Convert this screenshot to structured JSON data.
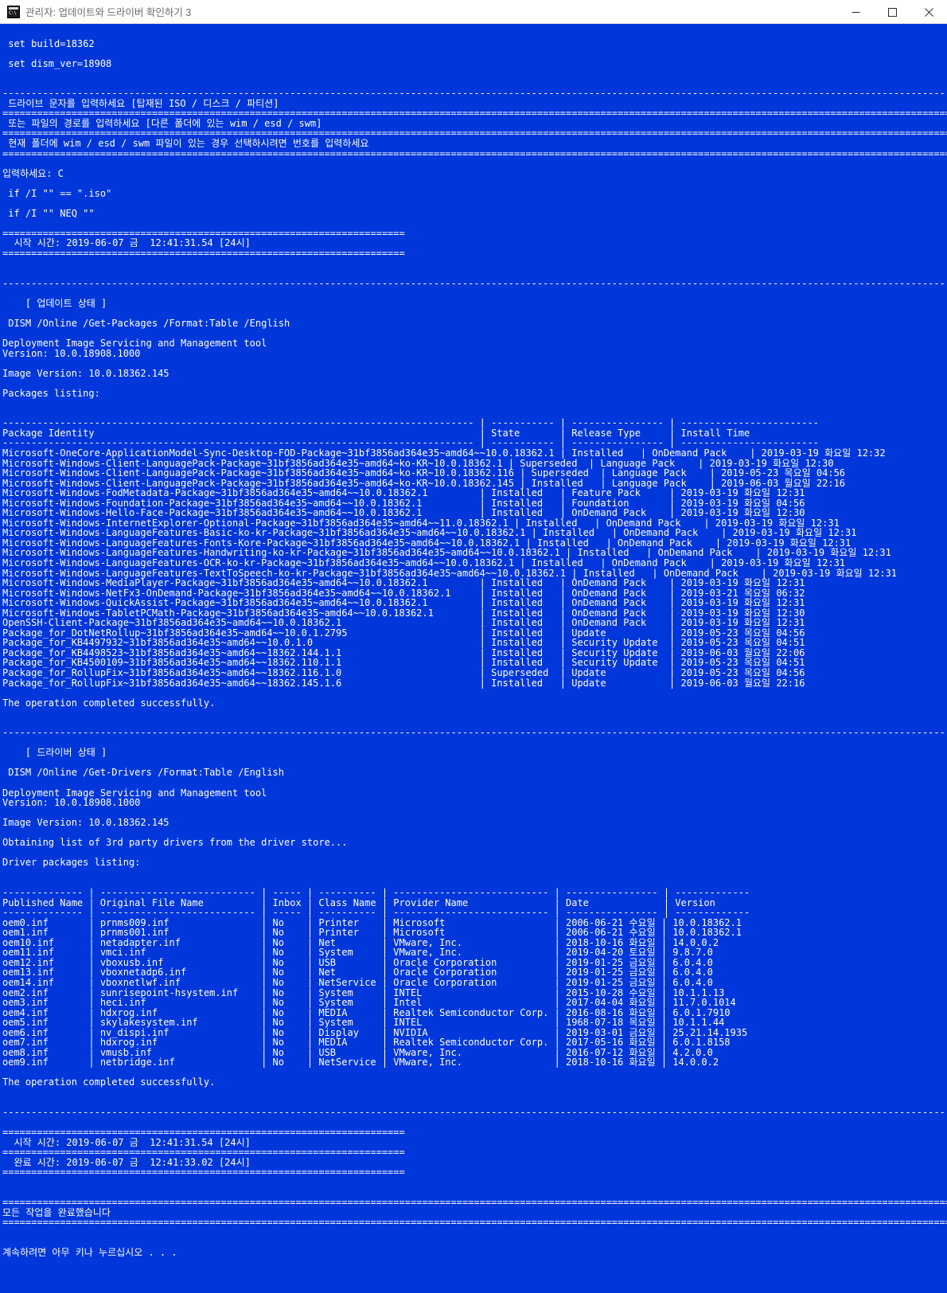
{
  "window": {
    "title": "관리자: 업데이트와 드라이버 확인하기 3",
    "icon": "console-icon",
    "minimize_label": "—",
    "maximize_label": "□",
    "close_label": "✕"
  },
  "colors": {
    "console_background": "#0037da",
    "console_text": "#ffffff",
    "titlebar_background": "#ffffff",
    "titlebar_text": "#6b6b6b"
  },
  "console": {
    "set_build": "set build=18362",
    "set_dism_ver": "set dism_ver=18908",
    "prompt_drive": "드라이브 문자를 입력하세요 [탑재된 ISO / 디스크 / 파티션]",
    "prompt_path": "또는 파일의 경로를 입력하세요 [다른 폴더에 있는 wim / esd / swm]",
    "prompt_number": "현재 폴더에 wim / esd / swm 파일이 있는 경우 선택하시려면 번호를 입력하세요",
    "input_line": "입력하세요: C",
    "if_iso": " if /I \"\" == \".iso\"",
    "if_neq": " if /I \"\" NEQ \"\"",
    "start_time_top": "  시작 시간: 2019-06-07 금  12:41:31.54 [24시]",
    "update_status_header": "    [ 업데이트 상태 ]",
    "dism_packages_cmd": " DISM /Online /Get-Packages /Format:Table /English",
    "dism_tool_line1": "Deployment Image Servicing and Management tool",
    "dism_tool_version": "Version: 10.0.18908.1000",
    "image_version": "Image Version: 10.0.18362.145",
    "packages_listing": "Packages listing:",
    "operation_completed": "The operation completed successfully.",
    "driver_status_header": "    [ 드라이버 상태 ]",
    "dism_drivers_cmd": " DISM /Online /Get-Drivers /Format:Table /English",
    "obtaining_drivers": "Obtaining list of 3rd party drivers from the driver store...",
    "driver_packages_listing": "Driver packages listing:",
    "start_time_bottom": "  시작 시간: 2019-06-07 금  12:41:31.54 [24시]",
    "end_time_bottom": "  완료 시간: 2019-06-07 금  12:41:33.02 [24시]",
    "all_done": "모든 작업을 완료했습니다",
    "press_any_key": "계속하려면 아무 키나 누르십시오 . . ."
  },
  "packages_table": {
    "headers": [
      "Package Identity",
      "State",
      "Release Type",
      "Install Time"
    ],
    "rows": [
      [
        "Microsoft-OneCore-ApplicationModel-Sync-Desktop-FOD-Package~31bf3856ad364e35~amd64~~10.0.18362.1",
        "Installed",
        "OnDemand Pack",
        "2019-03-19 화요일 12:32"
      ],
      [
        "Microsoft-Windows-Client-LanguagePack-Package~31bf3856ad364e35~amd64~ko-KR~10.0.18362.1",
        "Superseded",
        "Language Pack",
        "2019-03-19 화요일 12:30"
      ],
      [
        "Microsoft-Windows-Client-LanguagePack-Package~31bf3856ad364e35~amd64~ko-KR~10.0.18362.116",
        "Superseded",
        "Language Pack",
        "2019-05-23 목요일 04:56"
      ],
      [
        "Microsoft-Windows-Client-LanguagePack-Package~31bf3856ad364e35~amd64~ko-KR~10.0.18362.145",
        "Installed",
        "Language Pack",
        "2019-06-03 월요일 22:16"
      ],
      [
        "Microsoft-Windows-FodMetadata-Package~31bf3856ad364e35~amd64~~10.0.18362.1",
        "Installed",
        "Feature Pack",
        "2019-03-19 화요일 12:31"
      ],
      [
        "Microsoft-Windows-Foundation-Package~31bf3856ad364e35~amd64~~10.0.18362.1",
        "Installed",
        "Foundation",
        "2019-03-19 화요일 04:56"
      ],
      [
        "Microsoft-Windows-Hello-Face-Package~31bf3856ad364e35~amd64~~10.0.18362.1",
        "Installed",
        "OnDemand Pack",
        "2019-03-19 화요일 12:30"
      ],
      [
        "Microsoft-Windows-InternetExplorer-Optional-Package~31bf3856ad364e35~amd64~~11.0.18362.1",
        "Installed",
        "OnDemand Pack",
        "2019-03-19 화요일 12:31"
      ],
      [
        "Microsoft-Windows-LanguageFeatures-Basic-ko-kr-Package~31bf3856ad364e35~amd64~~10.0.18362.1",
        "Installed",
        "OnDemand Pack",
        "2019-03-19 화요일 12:31"
      ],
      [
        "Microsoft-Windows-LanguageFeatures-Fonts-Kore-Package~31bf3856ad364e35~amd64~~10.0.18362.1",
        "Installed",
        "OnDemand Pack",
        "2019-03-19 화요일 12:31"
      ],
      [
        "Microsoft-Windows-LanguageFeatures-Handwriting-ko-kr-Package~31bf3856ad364e35~amd64~~10.0.18362.1",
        "Installed",
        "OnDemand Pack",
        "2019-03-19 화요일 12:31"
      ],
      [
        "Microsoft-Windows-LanguageFeatures-OCR-ko-kr-Package~31bf3856ad364e35~amd64~~10.0.18362.1",
        "Installed",
        "OnDemand Pack",
        "2019-03-19 화요일 12:31"
      ],
      [
        "Microsoft-Windows-LanguageFeatures-TextToSpeech-ko-kr-Package~31bf3856ad364e35~amd64~~10.0.18362.1",
        "Installed",
        "OnDemand Pack",
        "2019-03-19 화요일 12:31"
      ],
      [
        "Microsoft-Windows-MediaPlayer-Package~31bf3856ad364e35~amd64~~10.0.18362.1",
        "Installed",
        "OnDemand Pack",
        "2019-03-19 화요일 12:31"
      ],
      [
        "Microsoft-Windows-NetFx3-OnDemand-Package~31bf3856ad364e35~amd64~~10.0.18362.1",
        "Installed",
        "OnDemand Pack",
        "2019-03-21 목요일 06:32"
      ],
      [
        "Microsoft-Windows-QuickAssist-Package~31bf3856ad364e35~amd64~~10.0.18362.1",
        "Installed",
        "OnDemand Pack",
        "2019-03-19 화요일 12:31"
      ],
      [
        "Microsoft-Windows-TabletPCMath-Package~31bf3856ad364e35~amd64~~10.0.18362.1",
        "Installed",
        "OnDemand Pack",
        "2019-03-19 화요일 12:30"
      ],
      [
        "OpenSSH-Client-Package~31bf3856ad364e35~amd64~~10.0.18362.1",
        "Installed",
        "OnDemand Pack",
        "2019-03-19 화요일 12:31"
      ],
      [
        "Package_for_DotNetRollup~31bf3856ad364e35~amd64~~10.0.1.2795",
        "Installed",
        "Update",
        "2019-05-23 목요일 04:56"
      ],
      [
        "Package_for_KB4497932~31bf3856ad364e35~amd64~~10.0.1.0",
        "Installed",
        "Security Update",
        "2019-05-23 목요일 04:51"
      ],
      [
        "Package_for_KB4498523~31bf3856ad364e35~amd64~~18362.144.1.1",
        "Installed",
        "Security Update",
        "2019-06-03 월요일 22:06"
      ],
      [
        "Package_for_KB4500109~31bf3856ad364e35~amd64~~18362.110.1.1",
        "Installed",
        "Security Update",
        "2019-05-23 목요일 04:51"
      ],
      [
        "Package_for_RollupFix~31bf3856ad364e35~amd64~~18362.116.1.0",
        "Superseded",
        "Update",
        "2019-05-23 목요일 04:56"
      ],
      [
        "Package_for_RollupFix~31bf3856ad364e35~amd64~~18362.145.1.6",
        "Installed",
        "Update",
        "2019-06-03 월요일 22:16"
      ]
    ]
  },
  "drivers_table": {
    "headers": [
      "Published Name",
      "Original File Name",
      "Inbox",
      "Class Name",
      "Provider Name",
      "Date",
      "Version"
    ],
    "rows": [
      [
        "oem0.inf",
        "prnms009.inf",
        "No",
        "Printer",
        "Microsoft",
        "2006-06-21 수요일",
        "10.0.18362.1"
      ],
      [
        "oem1.inf",
        "prnms001.inf",
        "No",
        "Printer",
        "Microsoft",
        "2006-06-21 수요일",
        "10.0.18362.1"
      ],
      [
        "oem10.inf",
        "netadapter.inf",
        "No",
        "Net",
        "VMware, Inc.",
        "2018-10-16 화요일",
        "14.0.0.2"
      ],
      [
        "oem11.inf",
        "vmci.inf",
        "No",
        "System",
        "VMware, Inc.",
        "2019-04-20 토요일",
        "9.8.7.0"
      ],
      [
        "oem12.inf",
        "vboxusb.inf",
        "No",
        "USB",
        "Oracle Corporation",
        "2019-01-25 금요일",
        "6.0.4.0"
      ],
      [
        "oem13.inf",
        "vboxnetadp6.inf",
        "No",
        "Net",
        "Oracle Corporation",
        "2019-01-25 금요일",
        "6.0.4.0"
      ],
      [
        "oem14.inf",
        "vboxnetlwf.inf",
        "No",
        "NetService",
        "Oracle Corporation",
        "2019-01-25 금요일",
        "6.0.4.0"
      ],
      [
        "oem2.inf",
        "sunrisepoint-hsystem.inf",
        "No",
        "System",
        "INTEL",
        "2015-10-28 수요일",
        "10.1.1.13"
      ],
      [
        "oem3.inf",
        "heci.inf",
        "No",
        "System",
        "Intel",
        "2017-04-04 화요일",
        "11.7.0.1014"
      ],
      [
        "oem4.inf",
        "hdxrog.inf",
        "No",
        "MEDIA",
        "Realtek Semiconductor Corp.",
        "2016-08-16 화요일",
        "6.0.1.7910"
      ],
      [
        "oem5.inf",
        "skylakesystem.inf",
        "No",
        "System",
        "INTEL",
        "1968-07-18 목요일",
        "10.1.1.44"
      ],
      [
        "oem6.inf",
        "nv_dispi.inf",
        "No",
        "Display",
        "NVIDIA",
        "2019-03-01 금요일",
        "25.21.14.1935"
      ],
      [
        "oem7.inf",
        "hdxrog.inf",
        "No",
        "MEDIA",
        "Realtek Semiconductor Corp.",
        "2017-05-16 화요일",
        "6.0.1.8158"
      ],
      [
        "oem8.inf",
        "vmusb.inf",
        "No",
        "USB",
        "VMware, Inc.",
        "2016-07-12 화요일",
        "4.2.0.0"
      ],
      [
        "oem9.inf",
        "netbridge.inf",
        "No",
        "NetService",
        "VMware, Inc.",
        "2018-10-16 화요일",
        "14.0.0.2"
      ]
    ]
  }
}
